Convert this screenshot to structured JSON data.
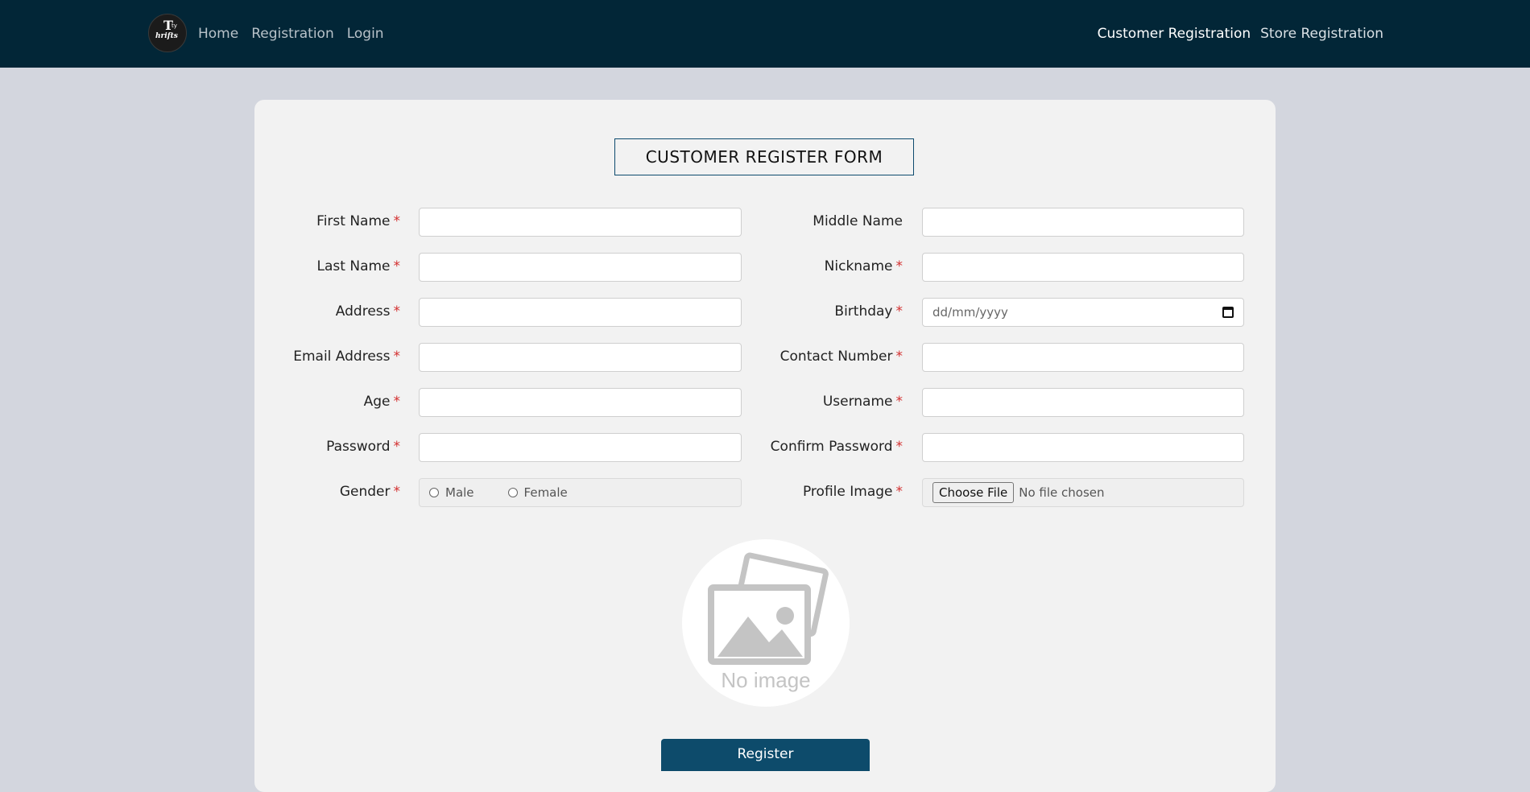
{
  "nav": {
    "logo_top": "T",
    "logo_small": "ty",
    "logo_bottom": "hrifts",
    "links": [
      "Home",
      "Registration",
      "Login"
    ],
    "right_links": [
      "Customer Registration",
      "Store Registration"
    ]
  },
  "form": {
    "title": "CUSTOMER REGISTER FORM",
    "required_mark": "*",
    "fields": {
      "first_name": "First Name",
      "middle_name": "Middle Name",
      "last_name": "Last Name",
      "nickname": "Nickname",
      "address": "Address",
      "birthday": "Birthday",
      "birthday_placeholder": "dd/mm/yyyy",
      "email": "Email Address",
      "contact": "Contact Number",
      "age": "Age",
      "username": "Username",
      "password": "Password",
      "confirm_password": "Confirm Password",
      "gender": "Gender",
      "gender_male": "Male",
      "gender_female": "Female",
      "profile_image": "Profile Image",
      "choose_file": "Choose File",
      "no_file": "No file chosen"
    },
    "preview_text": "No image",
    "submit": "Register"
  },
  "colors": {
    "navbar": "#022637",
    "accent": "#0d4b6b",
    "required": "#d32f2f"
  }
}
